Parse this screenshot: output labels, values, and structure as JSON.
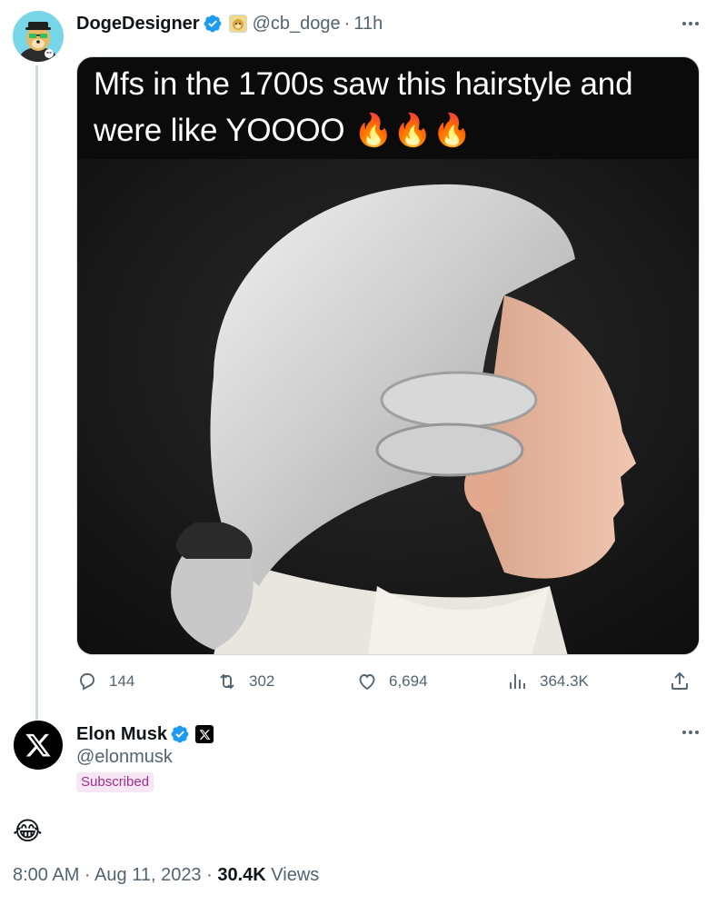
{
  "tweet1": {
    "display_name": "DogeDesigner",
    "handle": "@cb_doge",
    "separator": "·",
    "time": "11h",
    "caption": "Mfs in the 1700s saw this hairstyle and were like YOOOO 🔥🔥🔥",
    "actions": {
      "replies": "144",
      "reposts": "302",
      "likes": "6,694",
      "views": "364.3K"
    }
  },
  "tweet2": {
    "display_name": "Elon Musk",
    "handle": "@elonmusk",
    "subscribed_label": "Subscribed",
    "text": "😂",
    "timestamp": "8:00 AM · Aug 11, 2023 · ",
    "view_count": "30.4K",
    "views_label": " Views"
  },
  "colors": {
    "verified_blue": "#1d9bf0",
    "secondary_text": "#536471",
    "thread_line": "#cfd9de",
    "subscribed_bg": "#f7e6f4",
    "subscribed_text": "#9c2f8f"
  },
  "icons": {
    "reply": "reply-icon",
    "repost": "repost-icon",
    "like": "like-icon",
    "views": "views-icon",
    "share": "share-icon",
    "more": "more-icon",
    "verified": "verified-badge-icon"
  }
}
